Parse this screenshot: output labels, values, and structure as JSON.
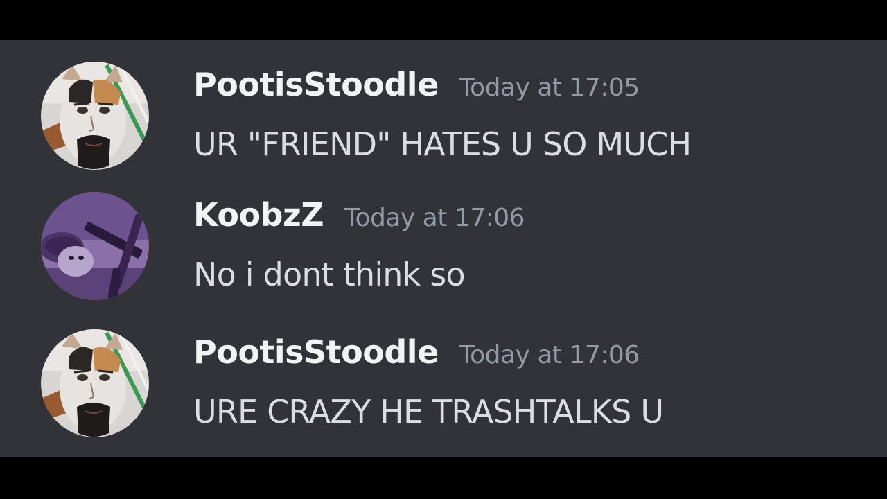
{
  "colors": {
    "background": "#313338",
    "letterbox": "#000000",
    "username": "#f2f3f5",
    "timestamp": "#949ba4",
    "message_text": "#dbdee1"
  },
  "messages": [
    {
      "username": "PootisStoodle",
      "timestamp": "Today at 17:05",
      "content": "UR \"FRIEND\" HATES U SO MUCH",
      "avatar": "cat-face-avatar-icon"
    },
    {
      "username": "KoobzZ",
      "timestamp": "Today at 17:06",
      "content": "No i dont think so",
      "avatar": "purple-cat-avatar-icon"
    },
    {
      "username": "PootisStoodle",
      "timestamp": "Today at 17:06",
      "content": "URE CRAZY HE TRASHTALKS U",
      "avatar": "cat-face-avatar-icon"
    }
  ]
}
